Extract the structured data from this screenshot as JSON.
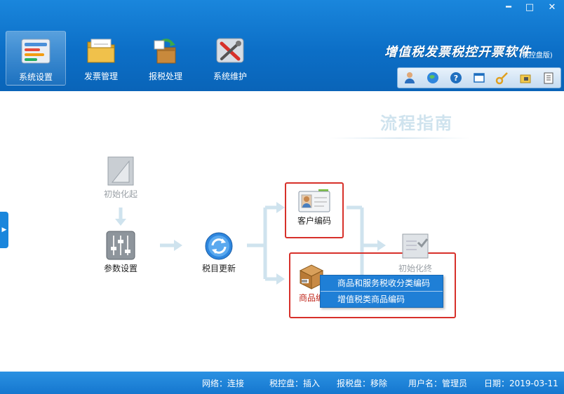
{
  "window": {
    "minimize_glyph": "━",
    "maximize_glyph": "□",
    "close_glyph": "✕"
  },
  "nav": [
    {
      "label": "系统设置",
      "icon": "settings-panel-icon",
      "active": true
    },
    {
      "label": "发票管理",
      "icon": "invoice-folder-icon",
      "active": false
    },
    {
      "label": "报税处理",
      "icon": "tax-report-icon",
      "active": false
    },
    {
      "label": "系统维护",
      "icon": "maintenance-tools-icon",
      "active": false
    }
  ],
  "brand": {
    "title": "增值税发票税控开票软件",
    "subtitle": "(税控盘版)"
  },
  "toolbar_icons": [
    "user-icon",
    "globe-icon",
    "help-icon",
    "window-icon",
    "key-icon",
    "lock-icon",
    "document-icon"
  ],
  "guide": {
    "title": "流程指南"
  },
  "flow": {
    "init_start": "初始化起",
    "param_settings": "参数设置",
    "tax_update": "税目更新",
    "customer_code": "客户编码",
    "product_code": "商品编",
    "init_end": "初始化终"
  },
  "context_menu": {
    "items": [
      "商品和服务税收分类编码",
      "增值税类商品编码"
    ]
  },
  "status": {
    "network": "网络：连接",
    "tax_disk": "税控盘：插入",
    "report_disk": "报税盘：移除",
    "user": "用户名：管理员",
    "date": "日期：2019-03-11"
  },
  "colors": {
    "header_blue": "#0c6fc7",
    "highlight_red": "#d7302a",
    "menu_blue": "#1f7fd6",
    "arrow_light_blue": "#cfe3ee"
  }
}
